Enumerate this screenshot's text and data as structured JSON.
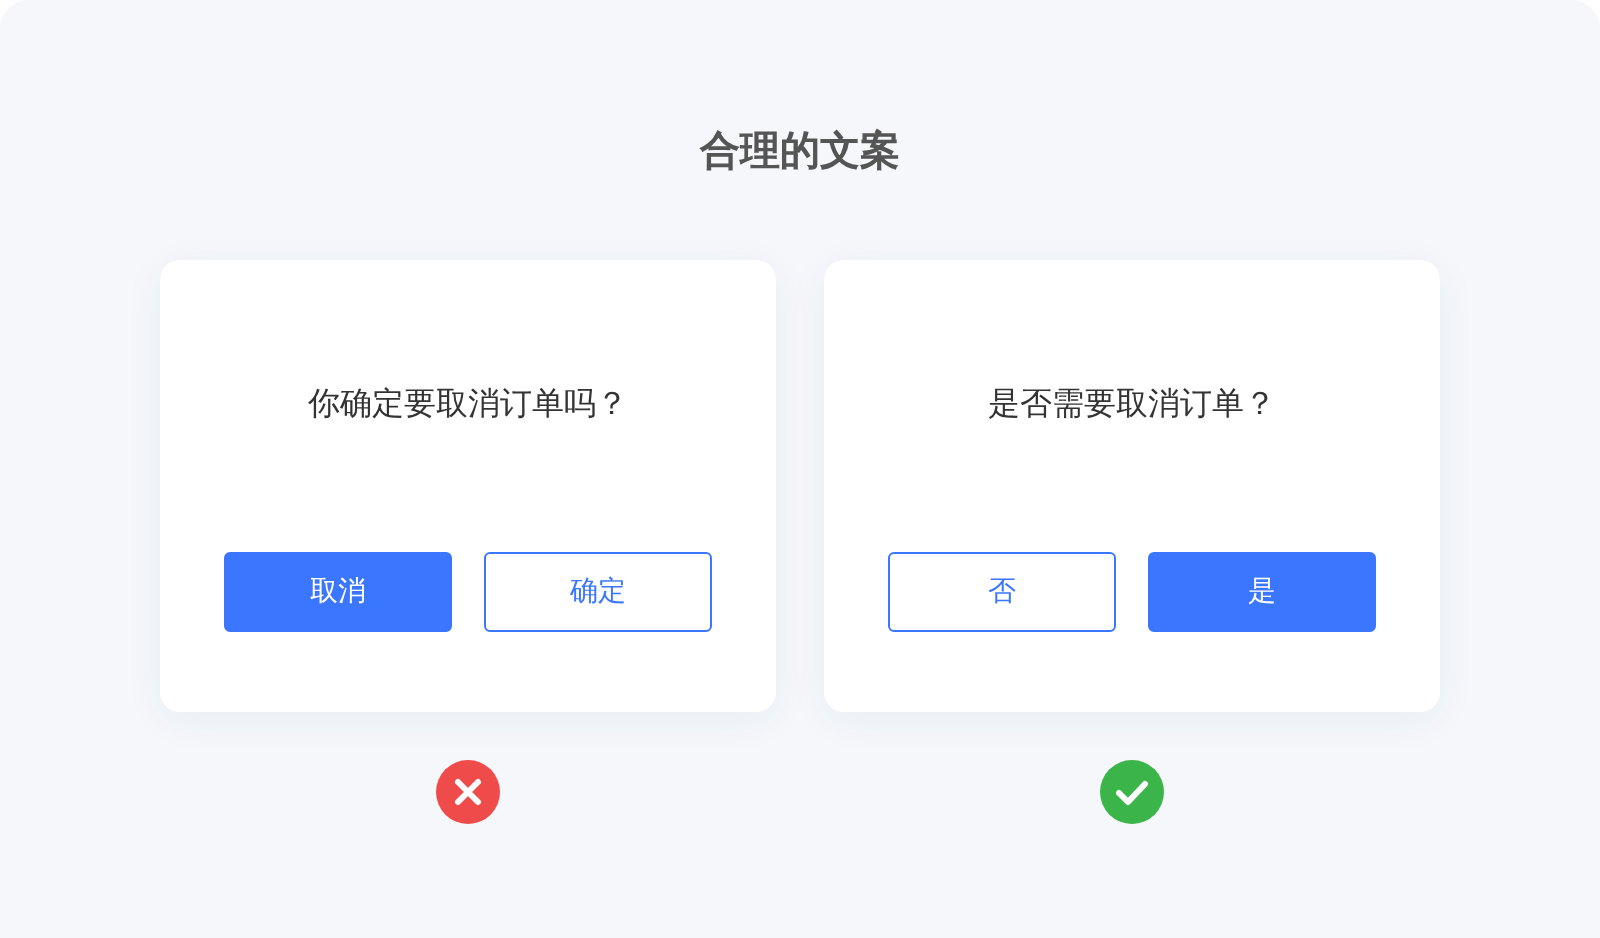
{
  "title": "合理的文案",
  "dialogs": [
    {
      "question": "你确定要取消订单吗？",
      "buttons": [
        {
          "label": "取消",
          "kind": "primary"
        },
        {
          "label": "确定",
          "kind": "outline"
        }
      ],
      "kind": "wrong"
    },
    {
      "question": "是否需要取消订单？",
      "buttons": [
        {
          "label": "否",
          "kind": "outline"
        },
        {
          "label": "是",
          "kind": "primary"
        }
      ],
      "kind": "right"
    }
  ]
}
